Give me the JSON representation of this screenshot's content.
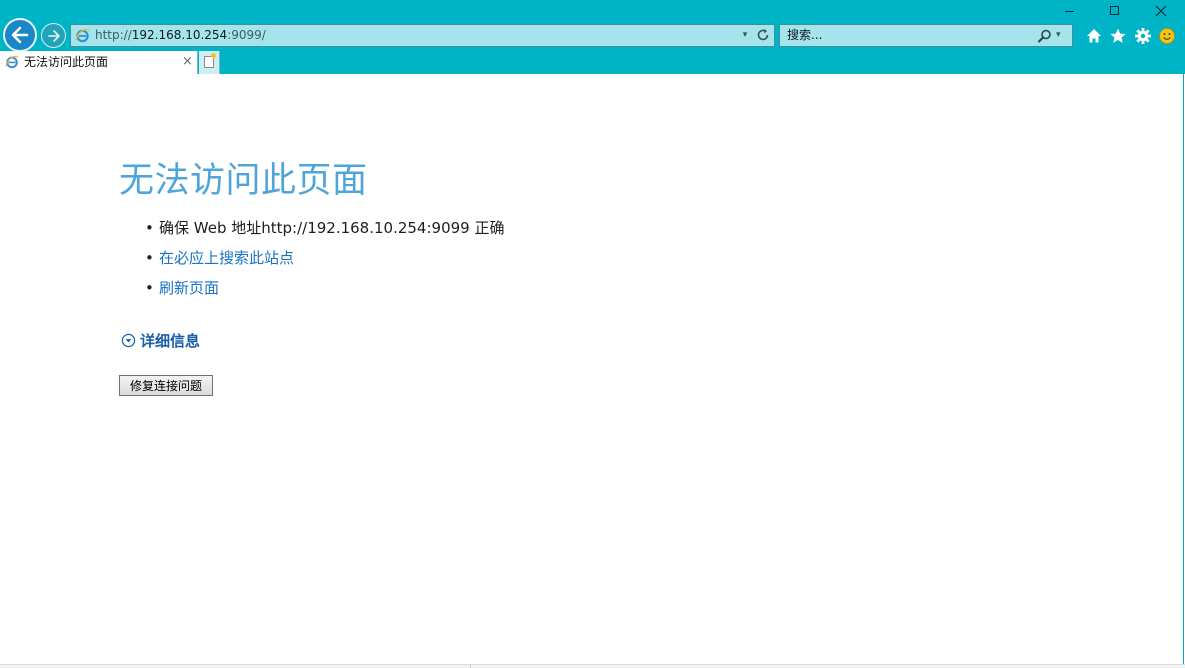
{
  "window": {
    "minimize": "minimize",
    "maximize": "maximize",
    "close": "close"
  },
  "nav": {
    "back_icon": "back-arrow-icon",
    "forward_icon": "forward-arrow-icon"
  },
  "address": {
    "url_prefix": "http://",
    "url_host": "192.168.10.254",
    "url_suffix": ":9099/",
    "dropdown_glyph": "▾"
  },
  "search": {
    "placeholder": "搜索...",
    "dropdown_glyph": "▾"
  },
  "toolbar": {
    "icons": [
      "home-icon",
      "favorites-star-icon",
      "tools-gear-icon",
      "feedback-smiley-icon"
    ]
  },
  "tab": {
    "title": "无法访问此页面",
    "close_glyph": "×"
  },
  "error_page": {
    "title": "无法访问此页面",
    "suggestions": [
      "确保 Web 地址http://192.168.10.254:9099 正确",
      "在必应上搜索此站点",
      "刷新页面"
    ],
    "details_label": "详细信息",
    "fix_button": "修复连接问题"
  },
  "colors": {
    "frame": "#00b4c8",
    "title": "#4fa5da",
    "link": "#1a73c4"
  }
}
